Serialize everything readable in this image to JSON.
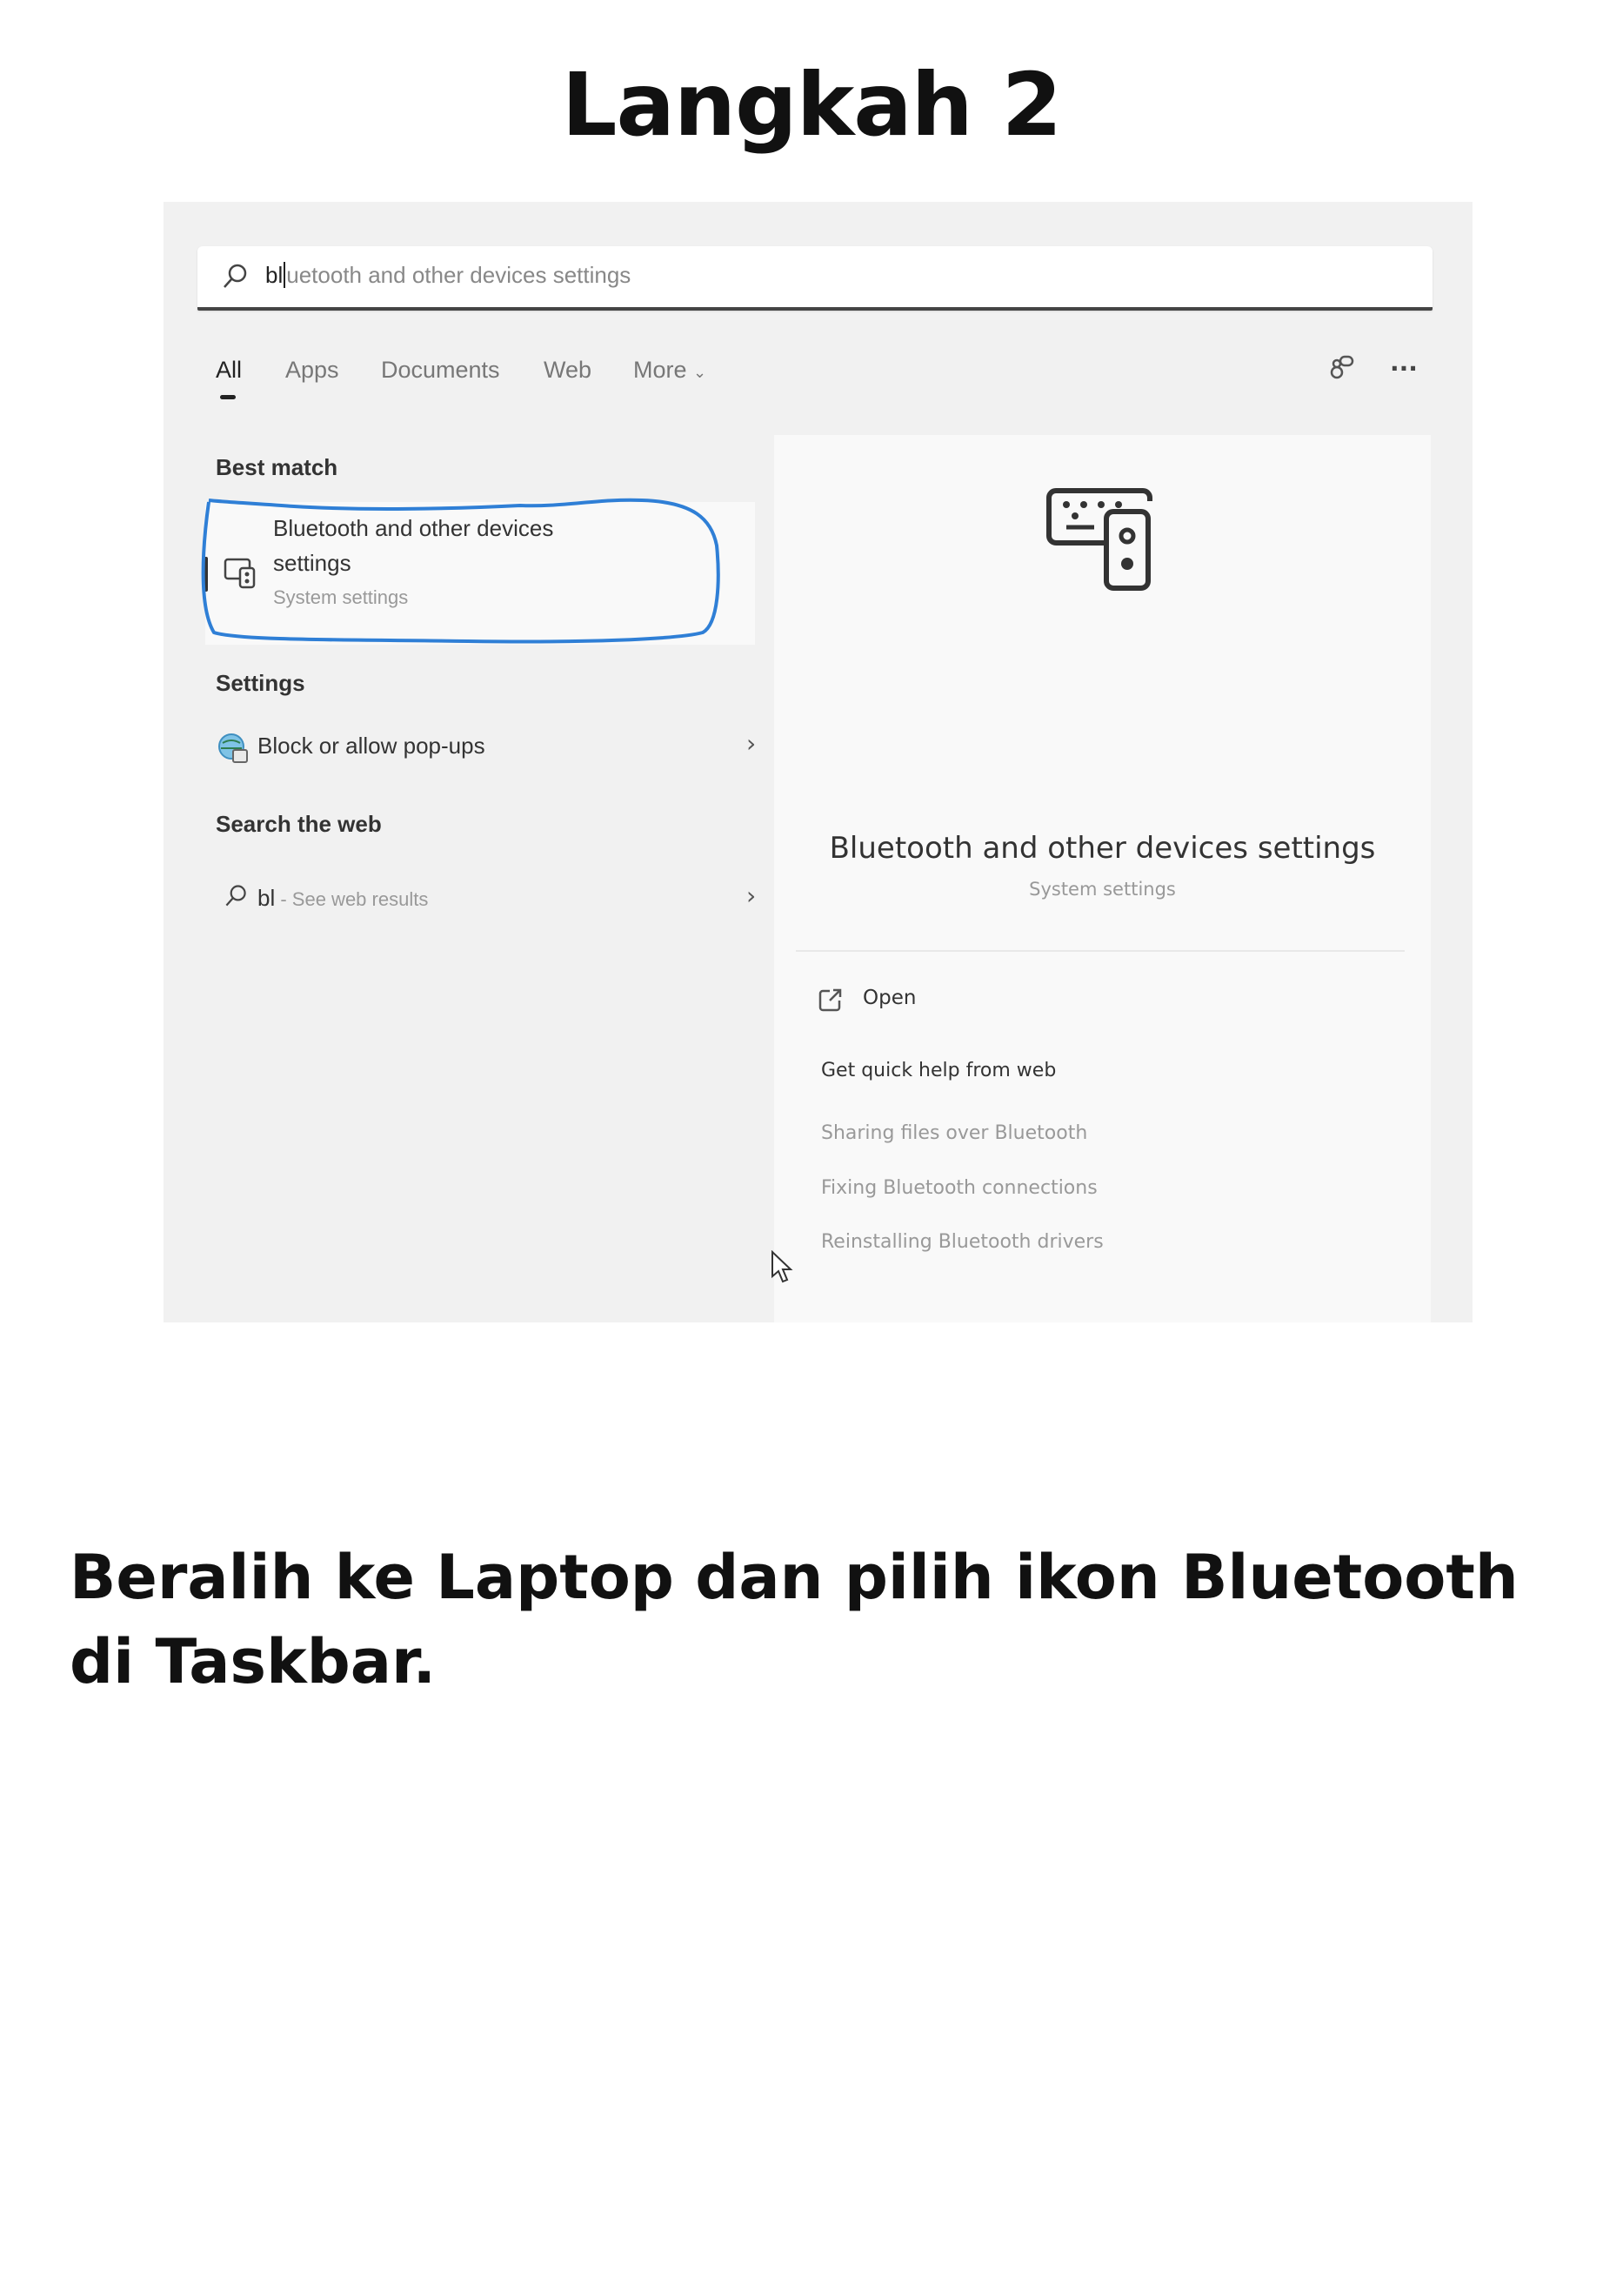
{
  "page_title": "Langkah 2",
  "search": {
    "typed": "bl",
    "suggestion": "uetooth and other devices settings",
    "icon": "search-icon"
  },
  "tabs": [
    {
      "label": "All",
      "active": true
    },
    {
      "label": "Apps"
    },
    {
      "label": "Documents"
    },
    {
      "label": "Web"
    },
    {
      "label": "More"
    }
  ],
  "toolbar": {
    "icons": [
      "share-icon",
      "more-options-icon"
    ],
    "more_label": "..."
  },
  "left": {
    "best_match_header": "Best match",
    "best_match": {
      "title_line1": "Bluetooth and other devices",
      "title_line2": "settings",
      "subtitle": "System settings",
      "icon": "devices-icon"
    },
    "settings_header": "Settings",
    "settings_item": {
      "label": "Block or allow pop-ups",
      "icon": "globe-settings-icon"
    },
    "web_header": "Search the web",
    "web_item": {
      "query": "bl",
      "suffix": " - See web results",
      "icon": "search-icon"
    }
  },
  "right": {
    "title": "Bluetooth and other devices settings",
    "subtitle": "System settings",
    "open_label": "Open",
    "quick_help_header": "Get quick help from web",
    "links": [
      "Sharing files over Bluetooth",
      "Fixing Bluetooth connections",
      "Reinstalling Bluetooth drivers"
    ]
  },
  "annotation_color": "#2f7fd6",
  "instruction": "Beralih ke Laptop dan pilih ikon Bluetooth di Taskbar."
}
